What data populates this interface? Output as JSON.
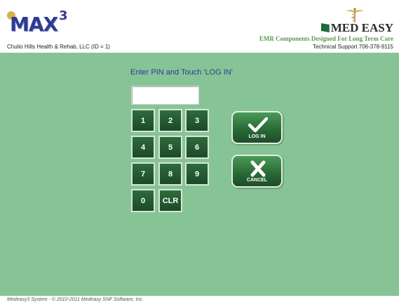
{
  "header": {
    "logo_text": "MAX",
    "logo_sup": "3",
    "facility": "Chulio Hills Health & Rehab, LLC (ID = 1)",
    "brand_name": "MED EASY",
    "tagline": "EMR Components Designed For Long Term Care",
    "support": "Technical Support 706-378-9115"
  },
  "login": {
    "prompt": "Enter PIN and Touch 'LOG IN'",
    "pin_value": "",
    "keys": [
      "1",
      "2",
      "3",
      "4",
      "5",
      "6",
      "7",
      "8",
      "9",
      "0",
      "CLR"
    ],
    "login_label": "LOG IN",
    "cancel_label": "CANCEL"
  },
  "footer": {
    "copyright": "Medeasy3 System - © 2010-2011 Medeasy SNF Software, Inc."
  },
  "colors": {
    "panel": "#87c495",
    "key": "#1f5a2f",
    "prompt": "#2a3a9a",
    "logo": "#2f3b8f"
  }
}
